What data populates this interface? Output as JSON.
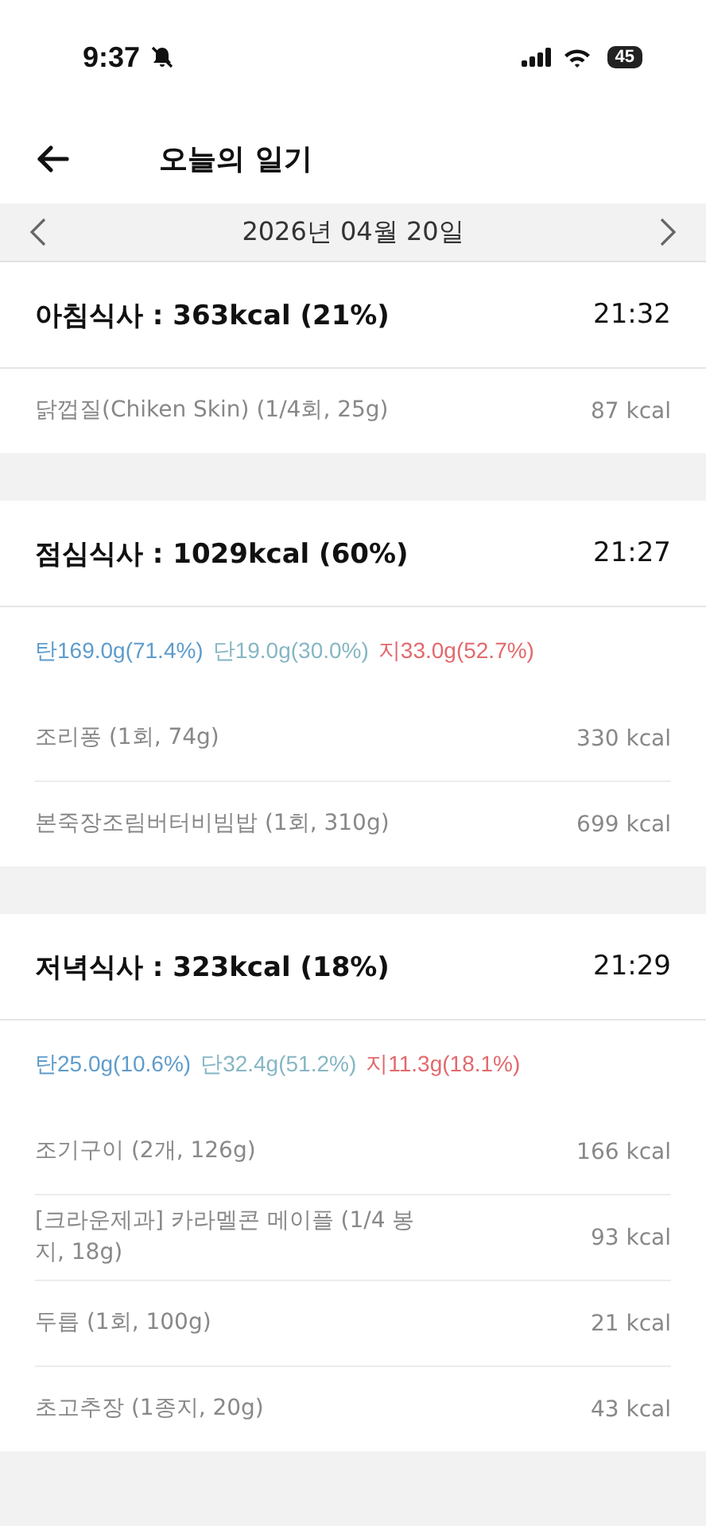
{
  "status_bar": {
    "time": "9:37",
    "battery": "45"
  },
  "header": {
    "title": "오늘의 일기"
  },
  "date_bar": {
    "date": "2026년 04월 20일"
  },
  "meals": [
    {
      "title": "아침식사 : 363kcal (21%)",
      "time": "21:32",
      "foods": [
        {
          "name": "닭껍질(Chiken Skin) (1/4회, 25g)",
          "kcal": "87 kcal"
        }
      ]
    },
    {
      "title": "점심식사 : 1029kcal (60%)",
      "time": "21:27",
      "macros": [
        {
          "text": "탄169.0g(71.4%)",
          "color": "#5e9ccc"
        },
        {
          "text": "단19.0g(30.0%)",
          "color": "#86b6c4"
        },
        {
          "text": "지33.0g(52.7%)",
          "color": "#e2696c"
        }
      ],
      "foods": [
        {
          "name": "조리퐁 (1회, 74g)",
          "kcal": "330 kcal"
        },
        {
          "name": "본죽장조림버터비빔밥 (1회, 310g)",
          "kcal": "699 kcal"
        }
      ]
    },
    {
      "title": "저녁식사 : 323kcal (18%)",
      "time": "21:29",
      "macros": [
        {
          "text": "탄25.0g(10.6%)",
          "color": "#5e9ccc"
        },
        {
          "text": "단32.4g(51.2%)",
          "color": "#86b6c4"
        },
        {
          "text": "지11.3g(18.1%)",
          "color": "#e2696c"
        }
      ],
      "foods": [
        {
          "name": "조기구이 (2개, 126g)",
          "kcal": "166 kcal"
        },
        {
          "name": "[크라운제과] 카라멜콘 메이플 (1/4 봉지, 18g)",
          "kcal": "93 kcal"
        },
        {
          "name": "두릅 (1회, 100g)",
          "kcal": "21 kcal"
        },
        {
          "name": "초고추장 (1종지, 20g)",
          "kcal": "43 kcal"
        }
      ]
    }
  ]
}
